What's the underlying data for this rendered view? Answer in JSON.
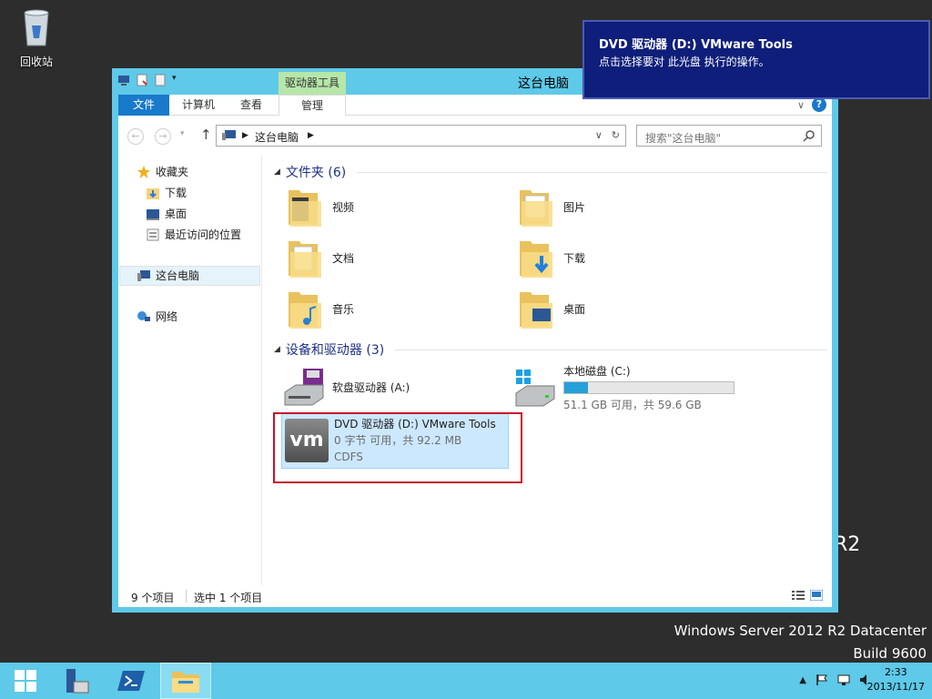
{
  "desktop": {
    "recycle_bin_label": "回收站",
    "watermark_line1": "Windows Server 2012 R2 Datacenter",
    "watermark_line2": "Build 9600",
    "r2_mark": "R2"
  },
  "window": {
    "title": "这台电脑",
    "context_tab_group": "驱动器工具",
    "ribbon_tabs": {
      "file": "文件",
      "computer": "计算机",
      "view": "查看",
      "manage": "管理"
    },
    "help_label": "?"
  },
  "navbar": {
    "address": "这台电脑",
    "search_placeholder": "搜索\"这台电脑\""
  },
  "nav_pane": {
    "favorites": "收藏夹",
    "downloads": "下载",
    "desktop": "桌面",
    "recent": "最近访问的位置",
    "this_pc": "这台电脑",
    "network": "网络"
  },
  "content": {
    "folders_header": "文件夹 (6)",
    "folders": [
      "视频",
      "图片",
      "文档",
      "下载",
      "音乐",
      "桌面"
    ],
    "devices_header": "设备和驱动器 (3)",
    "floppy": "软盘驱动器 (A:)",
    "local_disk": {
      "name": "本地磁盘 (C:)",
      "free": "51.1 GB 可用，共 59.6 GB",
      "used_fraction": 0.14
    },
    "dvd": {
      "name": "DVD 驱动器 (D:) VMware Tools",
      "free": "0 字节 可用，共 92.2 MB",
      "fs": "CDFS",
      "logo": "vm"
    }
  },
  "status": {
    "items": "9 个项目",
    "selected": "选中 1 个项目"
  },
  "toast": {
    "title": "DVD 驱动器 (D:) VMware Tools",
    "message": "点击选择要对 此光盘 执行的操作。"
  },
  "taskbar": {
    "time": "2:33",
    "date": "2013/11/17"
  },
  "colors": {
    "accent": "#1979ca",
    "window_frame": "#5ec9e8",
    "toast_bg": "#0e1e7a",
    "highlight_box": "#c8102e"
  }
}
